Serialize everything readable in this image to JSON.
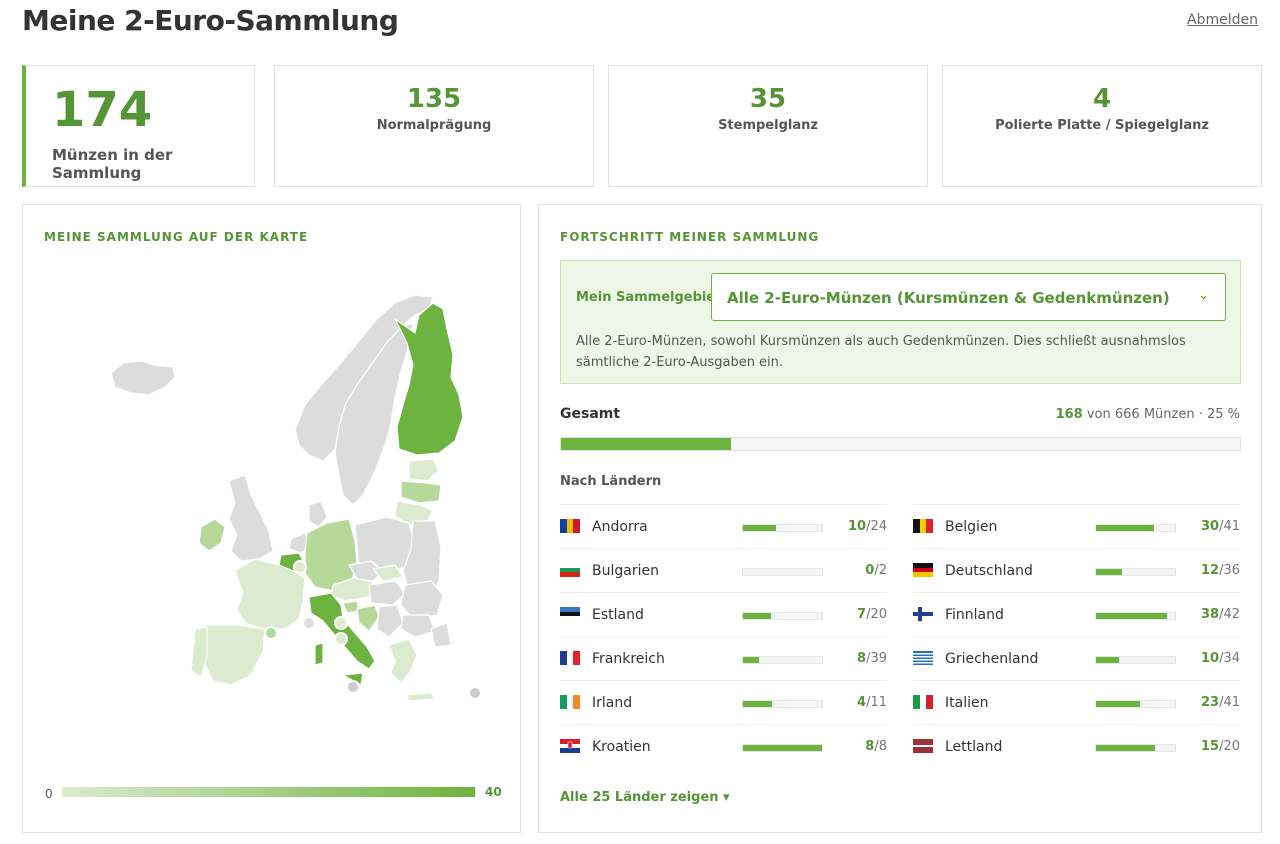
{
  "header": {
    "title": "Meine 2-Euro-Sammlung",
    "logout": "Abmelden"
  },
  "stats": {
    "total": {
      "value": "174",
      "label": "Münzen in der Sammlung"
    },
    "normal": {
      "value": "135",
      "label": "Normalprägung"
    },
    "bu": {
      "value": "35",
      "label": "Stempelglanz"
    },
    "proof": {
      "value": "4",
      "label": "Polierte Platte / Spiegelglanz"
    }
  },
  "map": {
    "heading": "MEINE SAMMLUNG AUF DER KARTE",
    "legend_min": "0",
    "legend_max": "40"
  },
  "progress": {
    "heading": "FORTSCHRITT MEINER SAMMLUNG",
    "area_label": "Mein Sammelgebiet",
    "area_value": "Alle 2-Euro-Münzen (Kursmünzen & Gedenkmünzen)",
    "area_description": "Alle 2-Euro-Münzen, sowohl Kursmünzen als auch Gedenkmünzen. Dies schließt ausnahmslos sämtliche 2-Euro-Ausgaben ein.",
    "total_label": "Gesamt",
    "total_have": "168",
    "total_rest": " von 666 Münzen · 25 %",
    "total_fraction": 0.25,
    "by_country_label": "Nach Ländern",
    "show_all": "Alle 25 Länder zeigen ▾"
  },
  "countries": [
    {
      "name": "Andorra",
      "have": "10",
      "total": "/24",
      "fraction": 0.417,
      "flag": "andorra-flag-icon"
    },
    {
      "name": "Belgien",
      "have": "30",
      "total": "/41",
      "fraction": 0.732,
      "flag": "belgium-flag-icon"
    },
    {
      "name": "Bulgarien",
      "have": "0",
      "total": "/2",
      "fraction": 0.0,
      "flag": "bulgaria-flag-icon"
    },
    {
      "name": "Deutschland",
      "have": "12",
      "total": "/36",
      "fraction": 0.333,
      "flag": "germany-flag-icon"
    },
    {
      "name": "Estland",
      "have": "7",
      "total": "/20",
      "fraction": 0.35,
      "flag": "estonia-flag-icon"
    },
    {
      "name": "Finnland",
      "have": "38",
      "total": "/42",
      "fraction": 0.905,
      "flag": "finland-flag-icon"
    },
    {
      "name": "Frankreich",
      "have": "8",
      "total": "/39",
      "fraction": 0.205,
      "flag": "france-flag-icon"
    },
    {
      "name": "Griechenland",
      "have": "10",
      "total": "/34",
      "fraction": 0.294,
      "flag": "greece-flag-icon"
    },
    {
      "name": "Irland",
      "have": "4",
      "total": "/11",
      "fraction": 0.364,
      "flag": "ireland-flag-icon"
    },
    {
      "name": "Italien",
      "have": "23",
      "total": "/41",
      "fraction": 0.561,
      "flag": "italy-flag-icon"
    },
    {
      "name": "Kroatien",
      "have": "8",
      "total": "/8",
      "fraction": 1.0,
      "flag": "croatia-flag-icon"
    },
    {
      "name": "Lettland",
      "have": "15",
      "total": "/20",
      "fraction": 0.75,
      "flag": "latvia-flag-icon"
    }
  ],
  "colors": {
    "accent": "#6db33f",
    "accent_text": "#559535",
    "map_empty": "#dcdcdc",
    "map_low": "#dcebcf",
    "map_mid": "#b6d99a",
    "map_high": "#6db33f"
  }
}
